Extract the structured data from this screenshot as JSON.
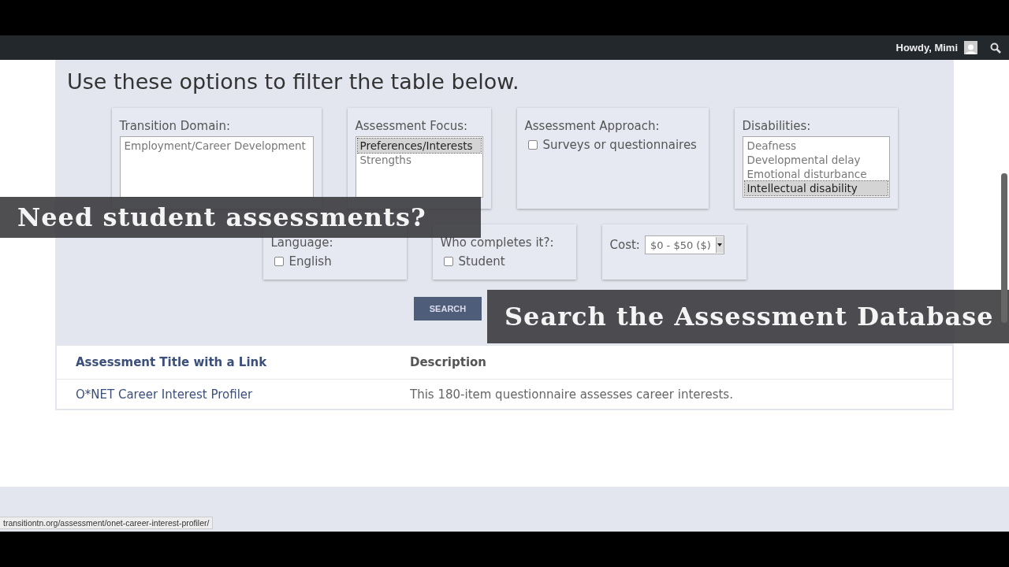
{
  "admin_bar": {
    "greeting": "Howdy, Mimi"
  },
  "heading": "Use these options to filter the table below.",
  "filters_row_1": [
    {
      "kind": "listbox",
      "label": "Transition Domain:",
      "options": [
        {
          "label": "Employment/Career Development",
          "selected": false
        }
      ]
    },
    {
      "kind": "listbox",
      "label": "Assessment Focus:",
      "options": [
        {
          "label": "Preferences/Interests",
          "selected": true
        },
        {
          "label": "Strengths",
          "selected": false
        }
      ]
    },
    {
      "kind": "checkboxes",
      "label": "Assessment Approach:",
      "options": [
        {
          "label": "Surveys or questionnaires",
          "checked": false
        }
      ]
    },
    {
      "kind": "listbox",
      "label": "Disabilities:",
      "options": [
        {
          "label": "Deafness",
          "selected": false
        },
        {
          "label": "Developmental delay",
          "selected": false
        },
        {
          "label": "Emotional disturbance",
          "selected": false
        },
        {
          "label": "Intellectual disability",
          "selected": true
        }
      ]
    }
  ],
  "filters_row_2": [
    {
      "kind": "checkboxes",
      "label": "Language:",
      "options": [
        {
          "label": "English",
          "checked": false
        }
      ]
    },
    {
      "kind": "checkboxes",
      "label": "Who completes it?:",
      "options": [
        {
          "label": "Student",
          "checked": false
        }
      ]
    },
    {
      "kind": "select",
      "label": "Cost:",
      "value": "$0 - $50 ($)"
    }
  ],
  "search_button": "SEARCH",
  "table": {
    "columns": [
      "Assessment Title with a Link",
      "Description"
    ],
    "rows": [
      {
        "title": "O*NET Career Interest Profiler",
        "description": "This 180-item questionnaire assesses career interests."
      }
    ]
  },
  "banners": [
    "Need student assessments?",
    "Search the Assessment Database"
  ],
  "status_url": "transitiontn.org/assessment/onet-career-interest-profiler/"
}
